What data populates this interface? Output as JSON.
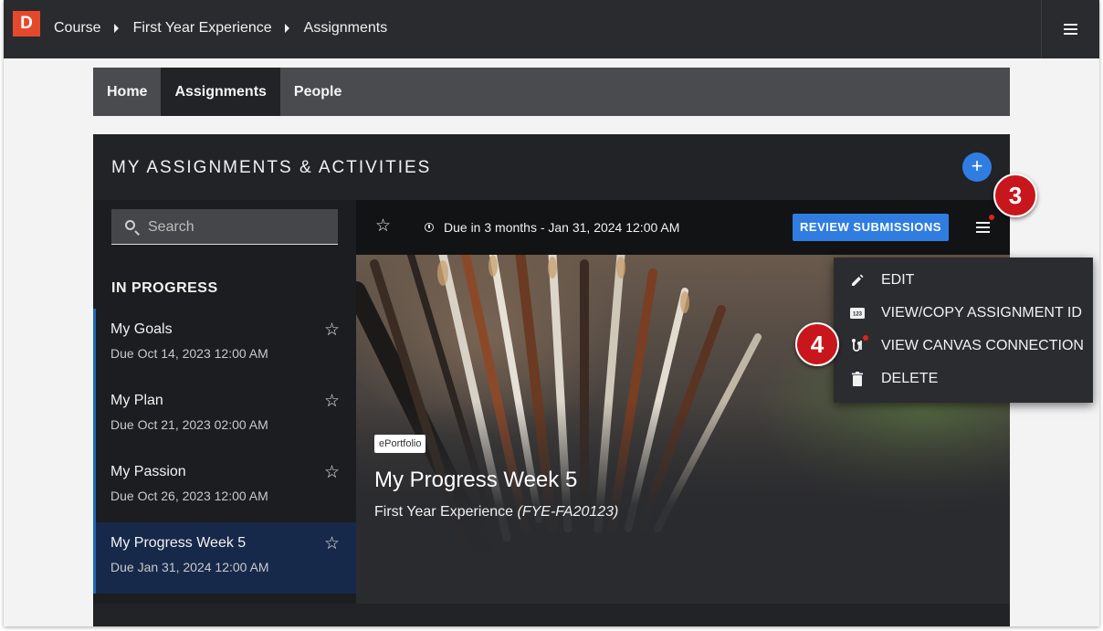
{
  "app": {
    "logo_letter": "D",
    "breadcrumbs": [
      "Course",
      "First Year Experience",
      "Assignments"
    ]
  },
  "nav_tabs": [
    {
      "label": "Home",
      "active": false
    },
    {
      "label": "Assignments",
      "active": true
    },
    {
      "label": "People",
      "active": false
    }
  ],
  "panel": {
    "title": "MY ASSIGNMENTS & ACTIVITIES",
    "add_label": "+"
  },
  "sidebar": {
    "search_placeholder": "Search",
    "section_heading": "IN PROGRESS",
    "items": [
      {
        "title": "My Goals",
        "due": "Due Oct 14, 2023 12:00 AM",
        "selected": false
      },
      {
        "title": "My Plan",
        "due": "Due Oct 21, 2023 02:00 AM",
        "selected": false
      },
      {
        "title": "My Passion",
        "due": "Due Oct 26, 2023 12:00 AM",
        "selected": false
      },
      {
        "title": "My Progress Week 5",
        "due": "Due Jan 31, 2024 12:00 AM",
        "selected": true
      }
    ]
  },
  "assignment": {
    "due_text": "Due in 3 months - Jan 31, 2024 12:00 AM",
    "review_button": "REVIEW SUBMISSIONS",
    "badge": "ePortfolio",
    "title": "My Progress Week 5",
    "course": "First Year Experience",
    "course_code": "(FYE-FA20123)"
  },
  "menu": {
    "items": [
      {
        "label": "EDIT",
        "icon": "pencil-icon"
      },
      {
        "label": "VIEW/COPY ASSIGNMENT ID",
        "icon": "numbers-icon"
      },
      {
        "label": "VIEW CANVAS CONNECTION",
        "icon": "connection-icon"
      },
      {
        "label": "DELETE",
        "icon": "trash-icon"
      }
    ]
  },
  "callouts": [
    "3",
    "4"
  ],
  "colors": {
    "accent": "#2f7de1",
    "brand": "#e5482a",
    "callout": "#c8161d",
    "notification_dot": "#e02020"
  }
}
